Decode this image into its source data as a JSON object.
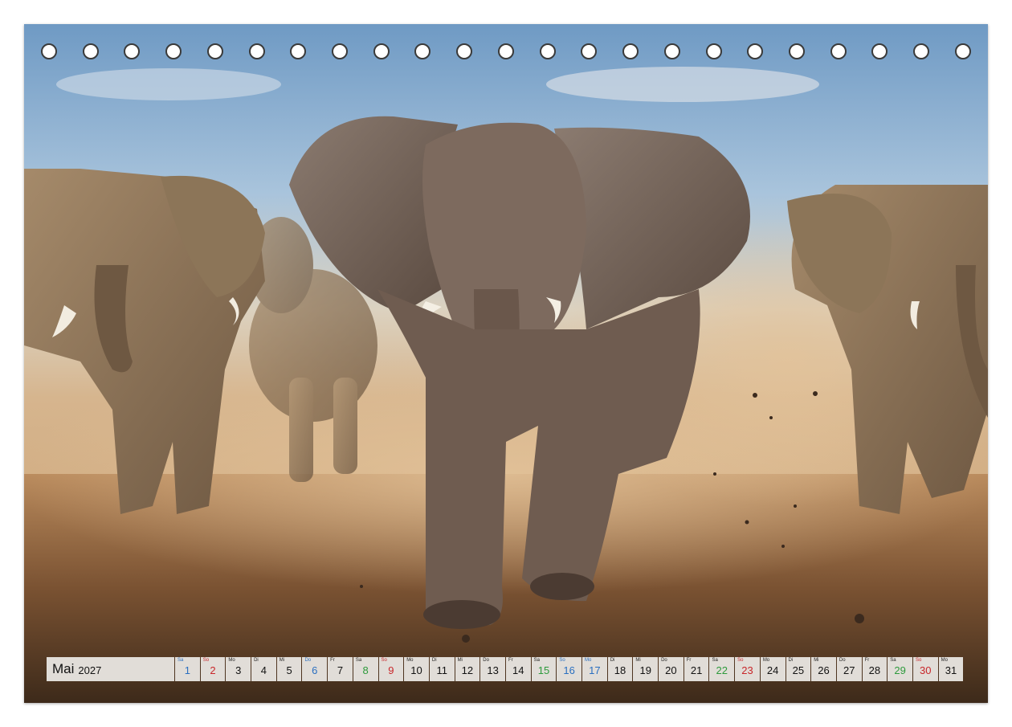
{
  "calendar": {
    "month": "Mai",
    "year": "2027",
    "days": [
      {
        "wd": "Sa",
        "num": "1",
        "type": "sat"
      },
      {
        "wd": "So",
        "num": "2",
        "type": "sun"
      },
      {
        "wd": "Mo",
        "num": "3",
        "type": ""
      },
      {
        "wd": "Di",
        "num": "4",
        "type": ""
      },
      {
        "wd": "Mi",
        "num": "5",
        "type": ""
      },
      {
        "wd": "Do",
        "num": "6",
        "type": "sat"
      },
      {
        "wd": "Fr",
        "num": "7",
        "type": ""
      },
      {
        "wd": "Sa",
        "num": "8",
        "type": "holiday"
      },
      {
        "wd": "So",
        "num": "9",
        "type": "sun"
      },
      {
        "wd": "Mo",
        "num": "10",
        "type": ""
      },
      {
        "wd": "Di",
        "num": "11",
        "type": ""
      },
      {
        "wd": "Mi",
        "num": "12",
        "type": ""
      },
      {
        "wd": "Do",
        "num": "13",
        "type": ""
      },
      {
        "wd": "Fr",
        "num": "14",
        "type": ""
      },
      {
        "wd": "Sa",
        "num": "15",
        "type": "holiday"
      },
      {
        "wd": "So",
        "num": "16",
        "type": "sat"
      },
      {
        "wd": "Mo",
        "num": "17",
        "type": "sat"
      },
      {
        "wd": "Di",
        "num": "18",
        "type": ""
      },
      {
        "wd": "Mi",
        "num": "19",
        "type": ""
      },
      {
        "wd": "Do",
        "num": "20",
        "type": ""
      },
      {
        "wd": "Fr",
        "num": "21",
        "type": ""
      },
      {
        "wd": "Sa",
        "num": "22",
        "type": "holiday"
      },
      {
        "wd": "So",
        "num": "23",
        "type": "sun"
      },
      {
        "wd": "Mo",
        "num": "24",
        "type": ""
      },
      {
        "wd": "Di",
        "num": "25",
        "type": ""
      },
      {
        "wd": "Mi",
        "num": "26",
        "type": ""
      },
      {
        "wd": "Do",
        "num": "27",
        "type": ""
      },
      {
        "wd": "Fr",
        "num": "28",
        "type": ""
      },
      {
        "wd": "Sa",
        "num": "29",
        "type": "holiday"
      },
      {
        "wd": "So",
        "num": "30",
        "type": "sun"
      },
      {
        "wd": "Mo",
        "num": "31",
        "type": ""
      }
    ]
  },
  "binding_holes": 23
}
